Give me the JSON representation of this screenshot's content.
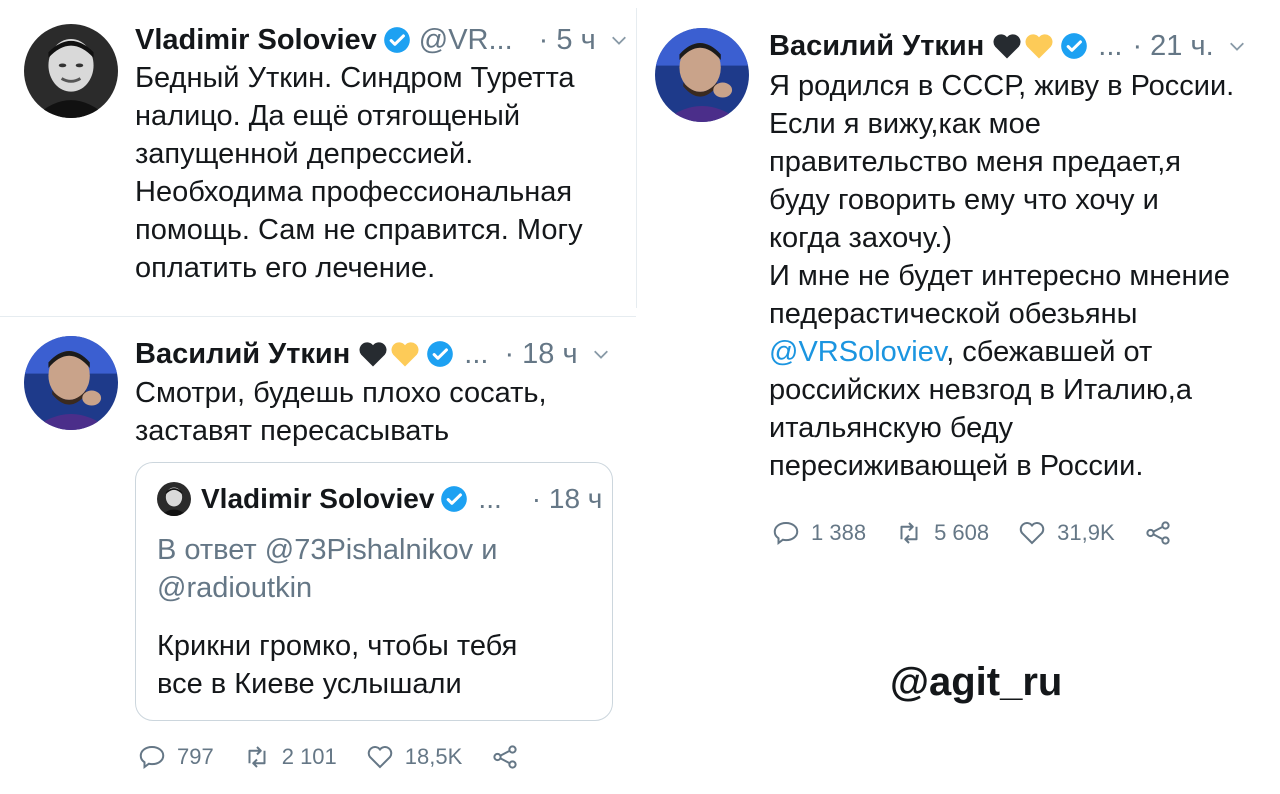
{
  "colors": {
    "link": "#1b95e0",
    "muted": "#657786",
    "verified": "#1da1f2",
    "border": "#e6ecf0"
  },
  "tweet1": {
    "name": "Vladimir Soloviev",
    "handle": "@VR...",
    "time": "· 5 ч",
    "lines": [
      "Бедный Уткин. Синдром Туретта",
      "налицо. Да ещё отягощеный",
      "запущенной депрессией.",
      "Необходима профессиональная",
      "помощь. Сам не справится. Могу",
      "оплатить его лечение."
    ]
  },
  "tweet2": {
    "name": "Василий Уткин",
    "dots": "...",
    "time": "· 18 ч",
    "lines": [
      "Смотри, будешь плохо сосать,",
      "заставят пересасывать"
    ],
    "quote": {
      "name": "Vladimir Soloviev",
      "dots": "...",
      "time": "· 18 ч",
      "reply_lines": [
        "В ответ @73Pishalnikov и",
        "@radioutkin"
      ],
      "lines": [
        "Крикни громко, чтобы тебя",
        "все в Киеве услышали"
      ]
    },
    "replies": "797",
    "retweets": "2 101",
    "likes": "18,5K"
  },
  "tweet3": {
    "name": "Василий Уткин",
    "dots": "...",
    "time": "· 21 ч.",
    "lines_a": [
      "Я родился в СССР, живу в России.",
      "Если я вижу,как мое",
      "правительство меня предает,я",
      "буду говорить ему что хочу и",
      "когда захочу.)",
      "И мне не будет интересно мнение",
      "педерастической обезьяны"
    ],
    "mention": "@VRSoloviev",
    "mention_rest": ", сбежавшей от",
    "lines_b": [
      "российских невзгод в Италию,а",
      "итальянскую беду",
      "пересиживающей в России."
    ],
    "replies": "1 388",
    "retweets": "5 608",
    "likes": "31,9K"
  },
  "watermark": "@agit_ru"
}
